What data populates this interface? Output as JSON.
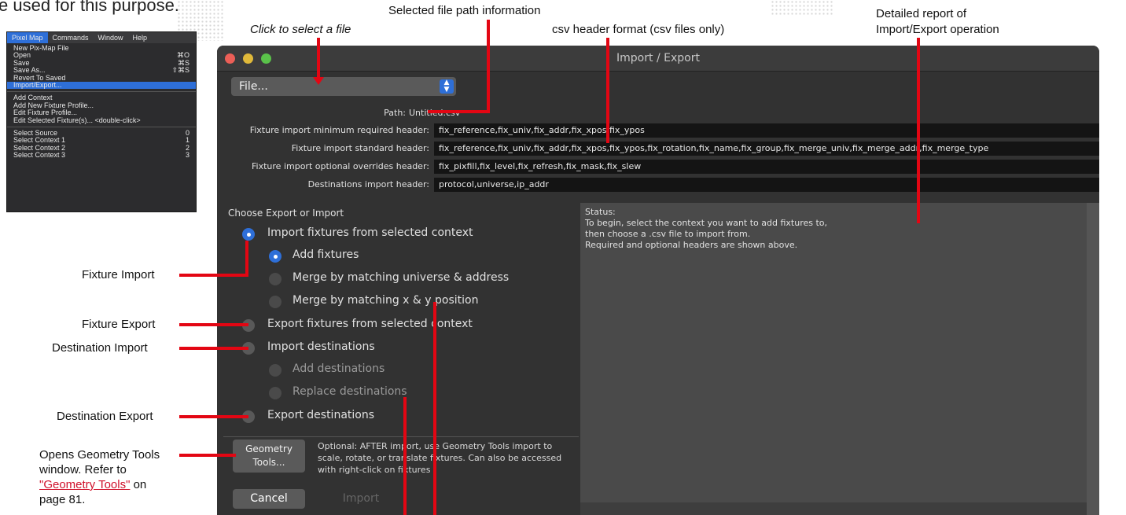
{
  "page_header_fragment": "e used for this purpose.",
  "menu": {
    "bar": [
      {
        "label": "Pixel Map",
        "selected": true
      },
      {
        "label": "Commands",
        "selected": false
      },
      {
        "label": "Window",
        "selected": false
      },
      {
        "label": "Help",
        "selected": false
      }
    ],
    "items": [
      {
        "label": "New Pix-Map File",
        "shortcut": ""
      },
      {
        "label": "Open",
        "shortcut": "⌘O"
      },
      {
        "label": "Save",
        "shortcut": "⌘S"
      },
      {
        "label": "Save As...",
        "shortcut": "⇧⌘S"
      },
      {
        "label": "Revert To Saved",
        "shortcut": ""
      },
      {
        "label": "Import/Export...",
        "shortcut": "",
        "selected": true
      },
      {
        "separator": true
      },
      {
        "label": "Add Context",
        "shortcut": ""
      },
      {
        "label": "Add New Fixture Profile...",
        "shortcut": ""
      },
      {
        "label": "Edit Fixture Profile...",
        "shortcut": ""
      },
      {
        "label": "Edit Selected Fixture(s)...   <double-click>",
        "shortcut": ""
      },
      {
        "separator": true
      },
      {
        "label": "Select Source",
        "shortcut": "0"
      },
      {
        "label": "Select Context 1",
        "shortcut": "1"
      },
      {
        "label": "Select Context 2",
        "shortcut": "2"
      },
      {
        "label": "Select Context 3",
        "shortcut": "3"
      }
    ]
  },
  "callouts": {
    "click_to_select": "Click to select a file",
    "selected_path_info": "Selected file path information",
    "csv_header_format": "csv header format (csv files only)",
    "detailed_report_line1": "Detailed report of",
    "detailed_report_line2": "Import/Export operation",
    "fixture_import": "Fixture Import",
    "fixture_export": "Fixture Export",
    "destination_import": "Destination Import",
    "destination_export": "Destination Export",
    "geometry_line1": "Opens Geometry Tools",
    "geometry_line2": "window. Refer to",
    "geometry_link": "\"Geometry Tools\"",
    "geometry_on": " on",
    "geometry_line4": "page 81."
  },
  "dialog": {
    "title": "Import / Export",
    "file_popup": "File...",
    "path_label": "Path:",
    "path_value": "Untitled.csv",
    "headers": [
      {
        "label": "Fixture import minimum required header:",
        "value": "fix_reference,fix_univ,fix_addr,fix_xpos,fix_ypos"
      },
      {
        "label": "Fixture import standard header:",
        "value": "fix_reference,fix_univ,fix_addr,fix_xpos,fix_ypos,fix_rotation,fix_name,fix_group,fix_merge_univ,fix_merge_addr,fix_merge_type"
      },
      {
        "label": "Fixture import optional overrides header:",
        "value": "fix_pixfill,fix_level,fix_refresh,fix_mask,fix_slew"
      },
      {
        "label": "Destinations import header:",
        "value": "protocol,universe,ip_addr"
      }
    ],
    "choose_title": "Choose Export or Import",
    "options": {
      "import_fixtures": "Import fixtures from selected context",
      "add_fixtures": "Add fixtures",
      "merge_univ_addr": "Merge by matching universe & address",
      "merge_xy": "Merge by matching x & y position",
      "export_fixtures": "Export fixtures from selected context",
      "import_destinations": "Import destinations",
      "add_destinations": "Add destinations",
      "replace_destinations": "Replace destinations",
      "export_destinations": "Export destinations"
    },
    "geometry_button_line1": "Geometry",
    "geometry_button_line2": "Tools...",
    "geometry_note": "Optional: AFTER import, use Geometry Tools import to scale, rotate, or translate fixtures.  Can also be accessed with right-click on fixtures",
    "cancel": "Cancel",
    "import": "Import",
    "status_title": "Status:",
    "status_lines": [
      "To begin, select the context you want to add fixtures to,",
      "then choose a .csv file to import from.",
      "Required and optional headers are shown above."
    ]
  },
  "colors": {
    "accent": "#e30613",
    "selection_blue": "#2e6fd8",
    "dialog_bg": "#323232"
  }
}
